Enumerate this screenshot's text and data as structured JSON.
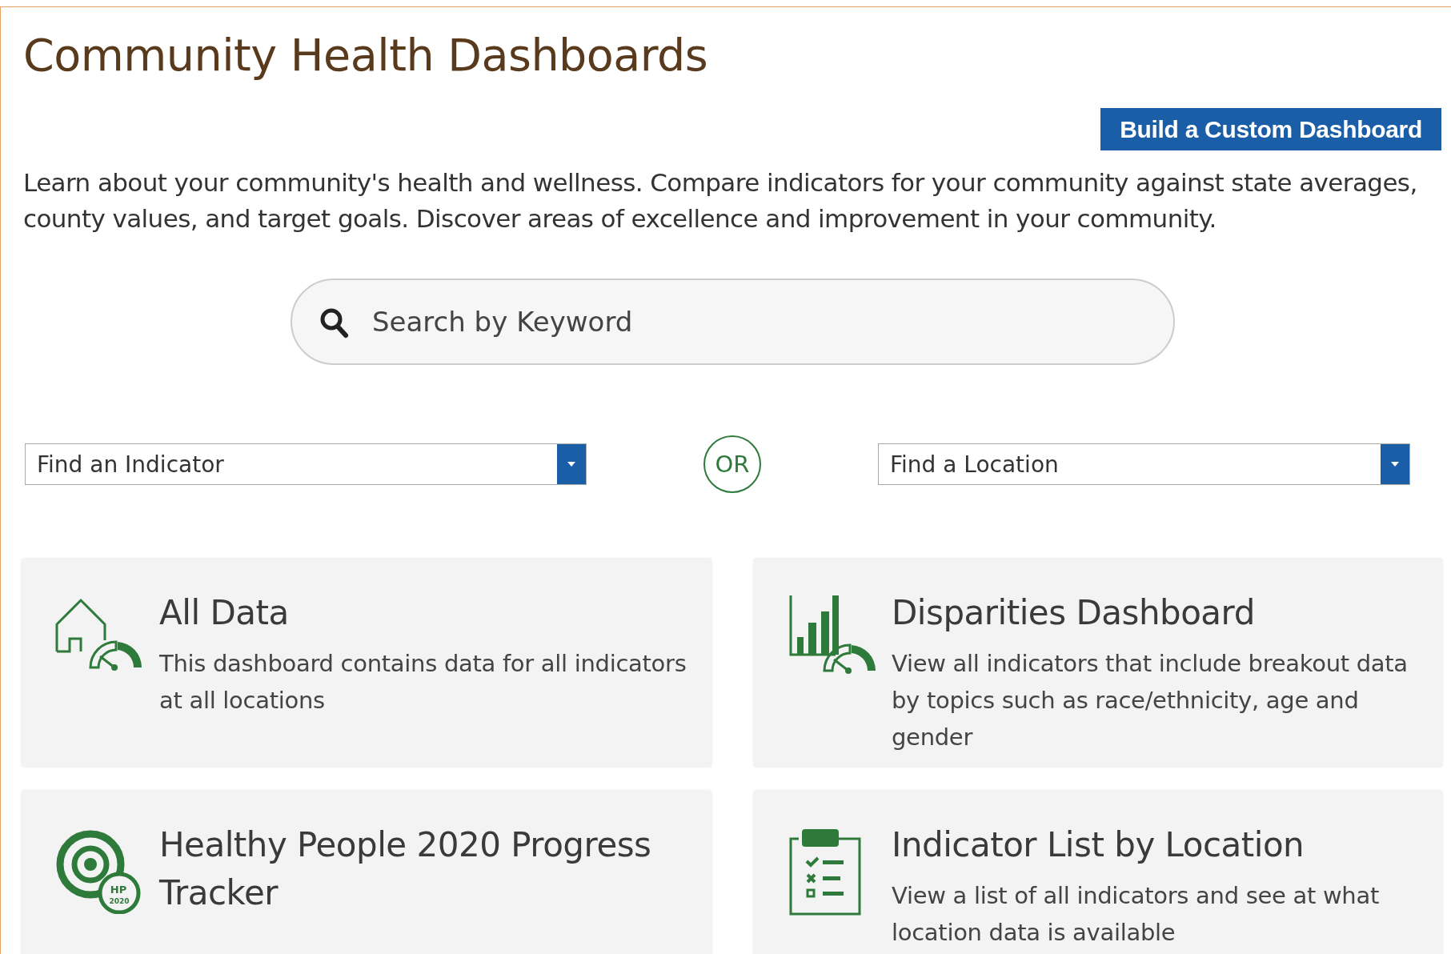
{
  "header": {
    "title": "Community Health Dashboards",
    "button": "Build a Custom Dashboard"
  },
  "intro": "Learn about your community's health and wellness. Compare indicators for your community against state averages, county values, and target goals. Discover areas of excellence and improvement in your community.",
  "search": {
    "placeholder": "Search by Keyword"
  },
  "filters": [
    {
      "label": "Find an Indicator"
    },
    {
      "label": "Find a Location"
    }
  ],
  "separator": "OR",
  "cards": [
    {
      "kind": "house-gauge",
      "title": "All Data",
      "description": "This dashboard contains data for all indicators at all locations"
    },
    {
      "kind": "bars-gauge",
      "title": "Disparities Dashboard",
      "description": "View all indicators that include breakout data by topics such as race/ethnicity, age and gender"
    },
    {
      "kind": "target-badge",
      "title": "Healthy People 2020 Progress Tracker",
      "badge": [
        "HP",
        "2020"
      ]
    },
    {
      "kind": "clipboard",
      "title": "Indicator List by Location",
      "description": "View a list of all indicators and see at what location data is available"
    }
  ]
}
